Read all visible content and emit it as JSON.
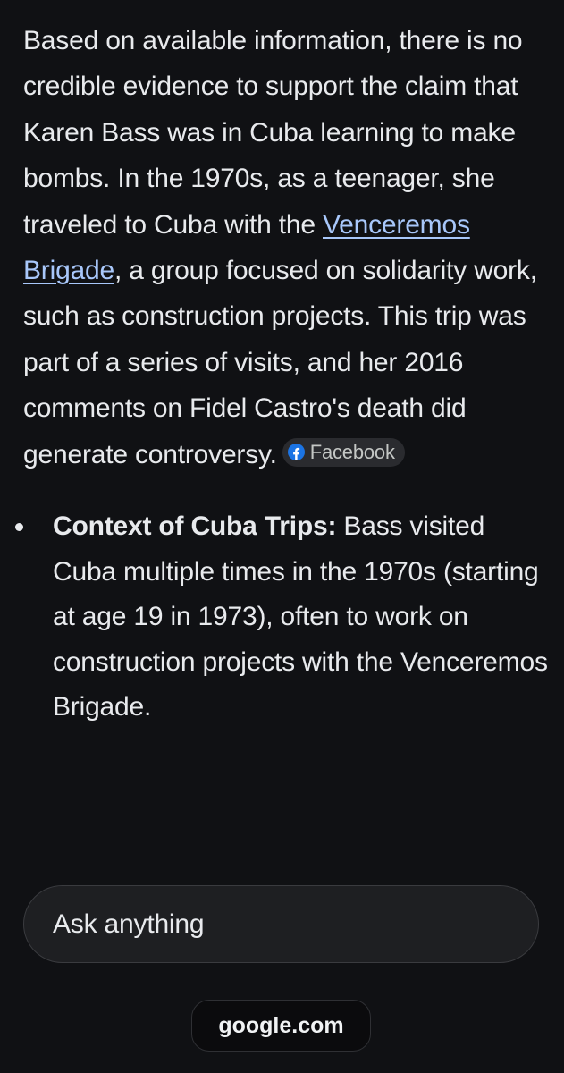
{
  "answer": {
    "paragraph": {
      "text_before_link": "Based on available information, there is no credible evidence to support the claim that Karen Bass was in Cuba learning to make bombs. In the 1970s, as a teenager, she traveled to Cuba with the ",
      "link_text": "Venceremos Brigade",
      "text_after_link": ", a group focused on solidarity work, such as construction projects. This trip was part of a series of visits, and her 2016 comments on Fidel Castro's death did generate controversy.",
      "source_chip": {
        "label": "Facebook",
        "icon": "facebook-icon",
        "icon_color": "#1b74e4"
      }
    },
    "bullets": [
      {
        "heading": "Context of Cuba Trips:",
        "text": " Bass visited Cuba multiple times in the 1970s (starting at age 19 in 1973), often to work on construction projects with the Venceremos Brigade."
      }
    ]
  },
  "composer": {
    "placeholder": "Ask anything"
  },
  "footer": {
    "domain": "google.com"
  },
  "colors": {
    "background": "#101114",
    "text": "#e8eaed",
    "link": "#a8c7fa",
    "chip_background": "#2a2b2f"
  }
}
